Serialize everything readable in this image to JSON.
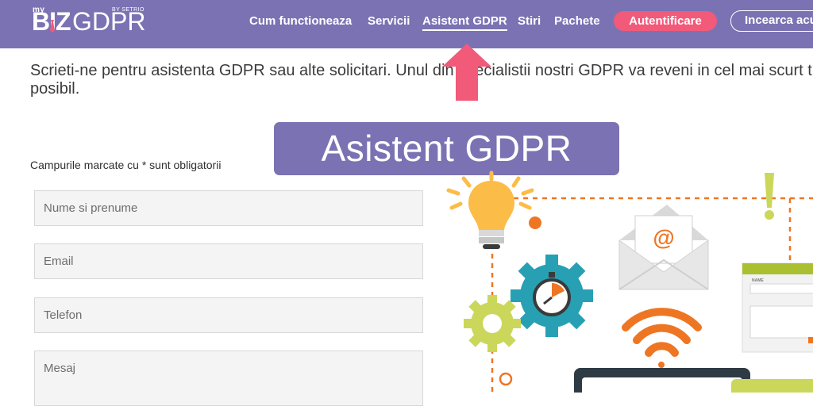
{
  "header": {
    "logo": {
      "prefix": "my",
      "brand_bold": "BIZ",
      "brand_light": "GDPR",
      "suffix": "BY SETRIO"
    },
    "nav": [
      {
        "label": "Cum functioneaza",
        "active": false
      },
      {
        "label": "Servicii",
        "active": false
      },
      {
        "label": "Asistent GDPR",
        "active": true
      },
      {
        "label": "Stiri",
        "active": false
      },
      {
        "label": "Pachete",
        "active": false
      }
    ],
    "login_button": "Autentificare",
    "try_button": "Incearca acum"
  },
  "intro_text": "Scrieti-ne pentru asistenta GDPR sau alte solicitari. Unul din specialistii nostri GDPR va reveni in cel mai scurt timp posibil.",
  "callout": {
    "label": "Asistent GDPR"
  },
  "form": {
    "required_note": "Campurile marcate cu * sunt obligatorii",
    "fields": [
      {
        "placeholder": "Nume si prenume"
      },
      {
        "placeholder": "Email"
      },
      {
        "placeholder": "Telefon"
      },
      {
        "placeholder": "Mesaj"
      }
    ]
  },
  "illustration": {
    "icons": [
      "light-bulb-icon",
      "envelope-icon",
      "gear-icon",
      "stopwatch-icon",
      "wifi-icon",
      "exclamation-icon",
      "form-window-icon",
      "laptop-icon"
    ],
    "colors": {
      "accent": "#7b72b3",
      "pink": "#f25a7a",
      "orange": "#ee7623",
      "teal": "#27a0b4",
      "yellow": "#fbbc48",
      "green": "#cbd75a"
    },
    "form_window_label": "NAME"
  }
}
